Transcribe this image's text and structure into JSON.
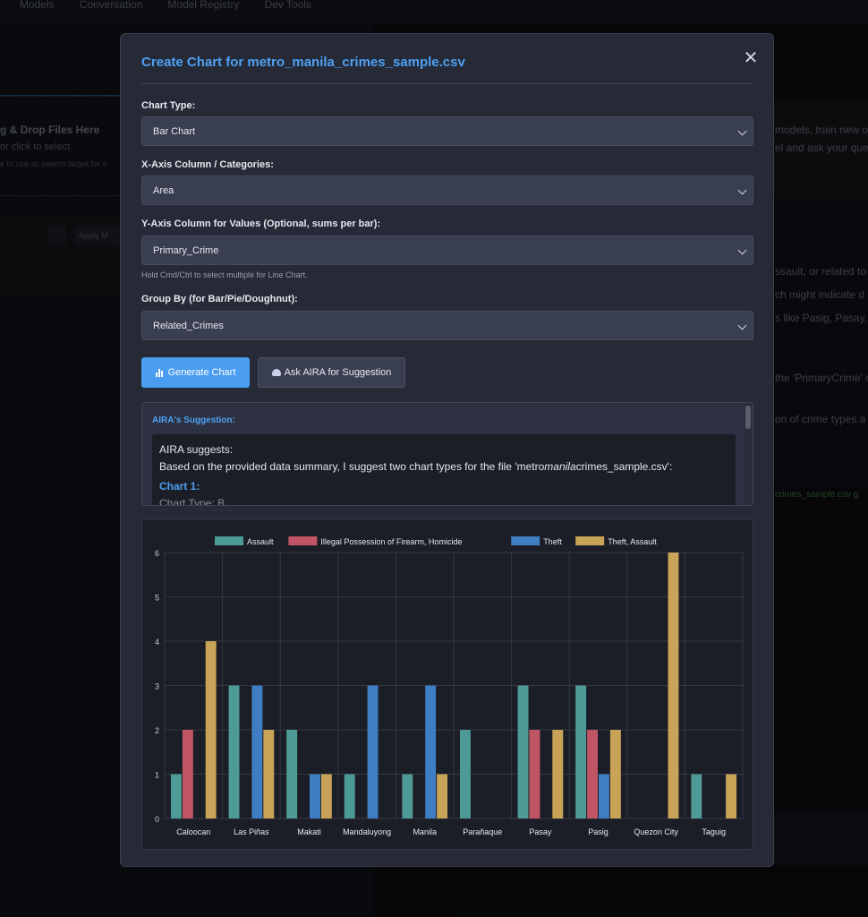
{
  "background": {
    "nav": [
      "Models",
      "Conversation",
      "Model Registry",
      "Dev Tools"
    ],
    "drop_title": "g & Drop Files Here",
    "drop_sub": "or click to select",
    "drop_hint": "e to use as search target for v",
    "apply_label": "Apply M",
    "right_lines": [
      "models, train new or",
      "el and ask your que",
      "ssault, or related to",
      "ch might indicate d",
      "s like Pasig, Pasay,",
      "the 'PrimaryCrime' c",
      "on of crime types a"
    ],
    "right_green": "crimes_sample.csv g"
  },
  "modal": {
    "title": "Create Chart for metro_manila_crimes_sample.csv",
    "close_icon": "✕",
    "chart_type_label": "Chart Type:",
    "chart_type_value": "Bar Chart",
    "x_label": "X-Axis Column / Categories:",
    "x_value": "Area",
    "y_label": "Y-Axis Column for Values (Optional, sums per bar):",
    "y_value": "Primary_Crime",
    "y_hint": "Hold Cmd/Ctrl to select multiple for Line Chart.",
    "group_label": "Group By (for Bar/Pie/Doughnut):",
    "group_value": "Related_Crimes",
    "generate_label": "Generate Chart",
    "ask_label": "Ask AIRA for Suggestion",
    "suggestion_title": "AIRA's Suggestion:",
    "suggestion_line1": "AIRA suggests:",
    "suggestion_line2": "Based on the provided data summary, I suggest two chart types for the file 'metro",
    "suggestion_line2_em": "manila",
    "suggestion_line2_end": "crimes_sample.csv':",
    "suggestion_heading": "Chart 1:",
    "suggestion_cut": "Chart Type: B"
  },
  "chart_data": {
    "type": "bar",
    "categories": [
      "Caloocan",
      "Las Piñas",
      "Makati",
      "Mandaluyong",
      "Manila",
      "Parañaque",
      "Pasay",
      "Pasig",
      "Quezon City",
      "Taguig"
    ],
    "series": [
      {
        "name": "Assault",
        "color": "#4e9a96",
        "values": [
          1,
          3,
          2,
          1,
          1,
          2,
          3,
          3,
          0,
          1
        ]
      },
      {
        "name": "Illegal Possession of Firearm, Homicide",
        "color": "#c05566",
        "values": [
          2,
          0,
          0,
          0,
          0,
          0,
          2,
          2,
          0,
          0
        ]
      },
      {
        "name": "Theft",
        "color": "#3f7ec2",
        "values": [
          0,
          3,
          1,
          3,
          3,
          0,
          0,
          1,
          0,
          0
        ]
      },
      {
        "name": "Theft, Assault",
        "color": "#c9a458",
        "values": [
          4,
          2,
          1,
          0,
          1,
          0,
          2,
          2,
          6,
          1
        ]
      }
    ],
    "ylim": [
      0,
      6
    ],
    "yticks": [
      "0",
      "1",
      "2",
      "3",
      "4",
      "5",
      "6"
    ],
    "legend_position": "top",
    "grid": true
  }
}
